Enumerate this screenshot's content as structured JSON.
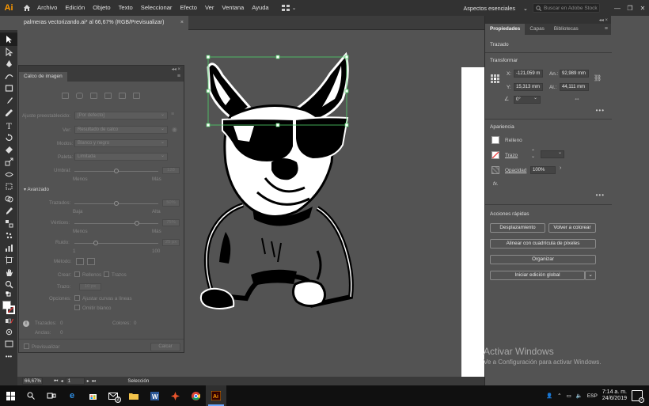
{
  "menubar": {
    "app_logo": "Ai",
    "items": [
      "Archivo",
      "Edición",
      "Objeto",
      "Texto",
      "Seleccionar",
      "Efecto",
      "Ver",
      "Ventana",
      "Ayuda"
    ],
    "workspace": "Aspectos esenciales",
    "search_placeholder": "Buscar en Adobe Stock"
  },
  "document_tab": {
    "title": "palmeras vectorizando.ai* al 66,67% (RGB/Previsualizar)",
    "close": "×"
  },
  "calco_panel": {
    "title": "Calco de imagen",
    "preset_label": "Ajuste preestablecido:",
    "preset_value": "[Por defecto]",
    "view_label": "Ver:",
    "view_value": "Resultado de calco",
    "mode_label": "Modos:",
    "mode_value": "Blanco y negro",
    "palette_label": "Paleta:",
    "palette_value": "Limitada",
    "threshold_label": "Umbral:",
    "threshold_value": "128",
    "threshold_min": "Menos",
    "threshold_max": "Más",
    "advanced_label": "Avanzado",
    "paths_label": "Trazados:",
    "paths_value": "50%",
    "paths_min": "Baja",
    "paths_max": "Alta",
    "corners_label": "Vértices:",
    "corners_value": "75%",
    "corners_min": "Menos",
    "corners_max": "Más",
    "noise_label": "Ruido:",
    "noise_value": "25 px",
    "noise_min": "1",
    "noise_max": "100",
    "method_label": "Método:",
    "create_label": "Crear:",
    "fills_label": "Rellenos",
    "strokes_label": "Trazos",
    "stroke_label": "Trazo:",
    "stroke_value": "10 px",
    "options_label": "Opciones:",
    "snap_label": "Ajustar curvas a líneas",
    "ignore_white_label": "Omitir blanco",
    "paths_count_label": "Trazados:",
    "paths_count_value": "0",
    "colors_label": "Colores:",
    "colors_value": "0",
    "anchors_label": "Anclas:",
    "anchors_value": "0",
    "preview_label": "Previsualizar",
    "trace_button": "Calcar",
    "top_controls": "◂◂  ×",
    "menu": "≡"
  },
  "props_panel": {
    "tabs": [
      "Propiedades",
      "Capas",
      "Bibliotecas"
    ],
    "selection_type": "Trazado",
    "transform_title": "Transformar",
    "x_label": "X:",
    "x_value": "-121,059 m",
    "y_label": "Y:",
    "y_value": "15,313 mm",
    "w_label": "An.:",
    "w_value": "92,989 mm",
    "h_label": "Al.:",
    "h_value": "44,111 mm",
    "angle_value": "0°",
    "appearance_title": "Apariencia",
    "fill_label": "Relleno",
    "stroke_label": "Trazo",
    "opacity_label": "Opacidad",
    "opacity_value": "100%",
    "fx_label": "fx.",
    "quick_actions_title": "Acciones rápidas",
    "btn_offset": "Desplazamiento",
    "btn_recolor": "Volver a colorear",
    "btn_align_grid": "Alinear con cuadrícula de píxeles",
    "btn_arrange": "Organizar",
    "btn_global_edit": "Iniciar edición global",
    "more": "•••",
    "top_controls": "◂◂  ×",
    "menu": "≡"
  },
  "watermark": {
    "line1": "Activar Windows",
    "line2": "Ve a Configuración para activar Windows."
  },
  "statusbar": {
    "zoom": "66,67%",
    "page": "1",
    "tool": "Selección"
  },
  "taskbar": {
    "lang": "ESP",
    "time": "7:14 a. m.",
    "date": "24/6/2019",
    "mail_badge": "2",
    "notif_badge": "2"
  },
  "colors": {
    "ai_orange": "#ff9a00",
    "selection_green": "#4fd36a",
    "ui_dark": "#323232",
    "ui_mid": "#535353"
  }
}
